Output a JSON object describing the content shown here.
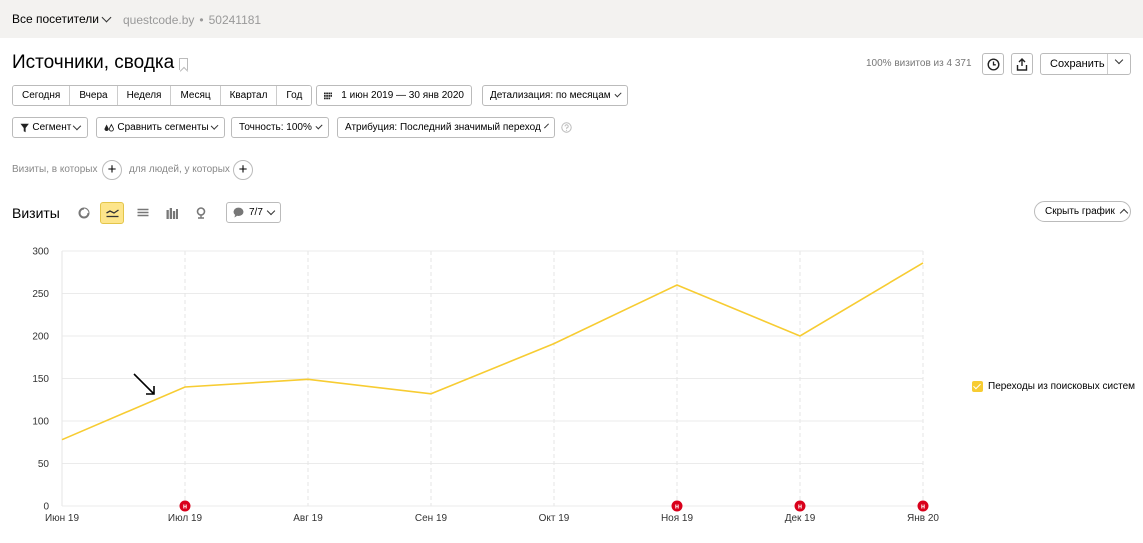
{
  "topbar": {
    "segment_label": "Все посетители",
    "site_name": "questcode.by",
    "separator": "•",
    "counter_id": "50241181"
  },
  "header": {
    "title": "Источники, сводка",
    "visits_note": "100% визитов из 4 371",
    "save_label": "Сохранить"
  },
  "periods": [
    "Сегодня",
    "Вчера",
    "Неделя",
    "Месяц",
    "Квартал",
    "Год"
  ],
  "date_range": "1 июн 2019 — 30 янв 2020",
  "detail_label": "Детализация: по месяцам",
  "filters": {
    "segment": "Сегмент",
    "compare": "Сравнить сегменты",
    "accuracy": "Точность: 100%",
    "attribution": "Атрибуция: Последний значимый переход"
  },
  "conditions": {
    "visits_text": "Визиты, в которых",
    "people_text": "для людей, у которых"
  },
  "chart_section": {
    "title": "Визиты",
    "series_count": "7/7",
    "hide_label": "Скрыть график"
  },
  "colors": {
    "line": "#f7cc32",
    "marker": "#d9001b",
    "active_view": "#fde58b"
  },
  "chart_data": {
    "type": "line",
    "categories": [
      "Июн 19",
      "Июл 19",
      "Авг 19",
      "Сен 19",
      "Окт 19",
      "Ноя 19",
      "Дек 19",
      "Янв 20"
    ],
    "series": [
      {
        "name": "Переходы из поисковых систем",
        "values": [
          78,
          140,
          149,
          132,
          191,
          260,
          200,
          286
        ]
      }
    ],
    "ylim": [
      0,
      300
    ],
    "yticks": [
      0,
      50,
      100,
      150,
      200,
      250,
      300
    ],
    "grid": true,
    "legend": "right",
    "annotation_marker_label": "н",
    "annotation_months": [
      "Июл 19",
      "Ноя 19",
      "Дек 19",
      "Янв 20"
    ]
  }
}
